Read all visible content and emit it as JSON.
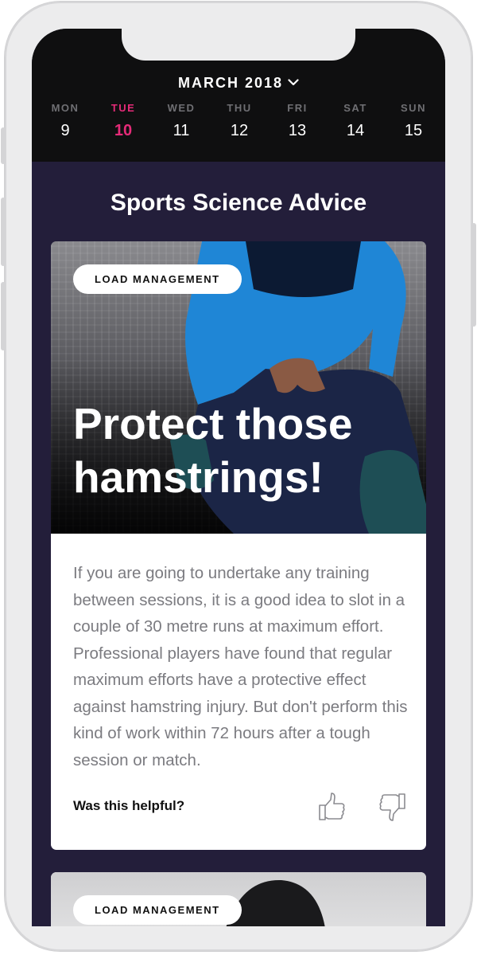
{
  "calendar": {
    "month": "MARCH 2018",
    "days": [
      {
        "name": "MON",
        "date": "9",
        "active": false
      },
      {
        "name": "TUE",
        "date": "10",
        "active": true
      },
      {
        "name": "WED",
        "date": "11",
        "active": false
      },
      {
        "name": "THU",
        "date": "12",
        "active": false
      },
      {
        "name": "FRI",
        "date": "13",
        "active": false
      },
      {
        "name": "SAT",
        "date": "14",
        "active": false
      },
      {
        "name": "SUN",
        "date": "15",
        "active": false
      }
    ]
  },
  "section": {
    "title": "Sports Science Advice"
  },
  "cards": [
    {
      "tag": "LOAD MANAGEMENT",
      "title": "Protect those hamstrings!",
      "body": "If you are going to undertake any training between sessions, it is a good idea to slot in a couple of 30 metre runs at maximum effort. Professional players have found that regular maximum efforts have a protective effect against hamstring injury. But don't perform this kind of work within 72 hours after a tough session or match.",
      "helpful_label": "Was this helpful?"
    },
    {
      "tag": "LOAD MANAGEMENT"
    }
  ],
  "colors": {
    "active_day": "#e52b78",
    "screen_bg": "#231e3a",
    "header_bg": "#0f0f10"
  },
  "icons": [
    "chevron-down-icon",
    "thumbs-up-icon",
    "thumbs-down-icon"
  ]
}
